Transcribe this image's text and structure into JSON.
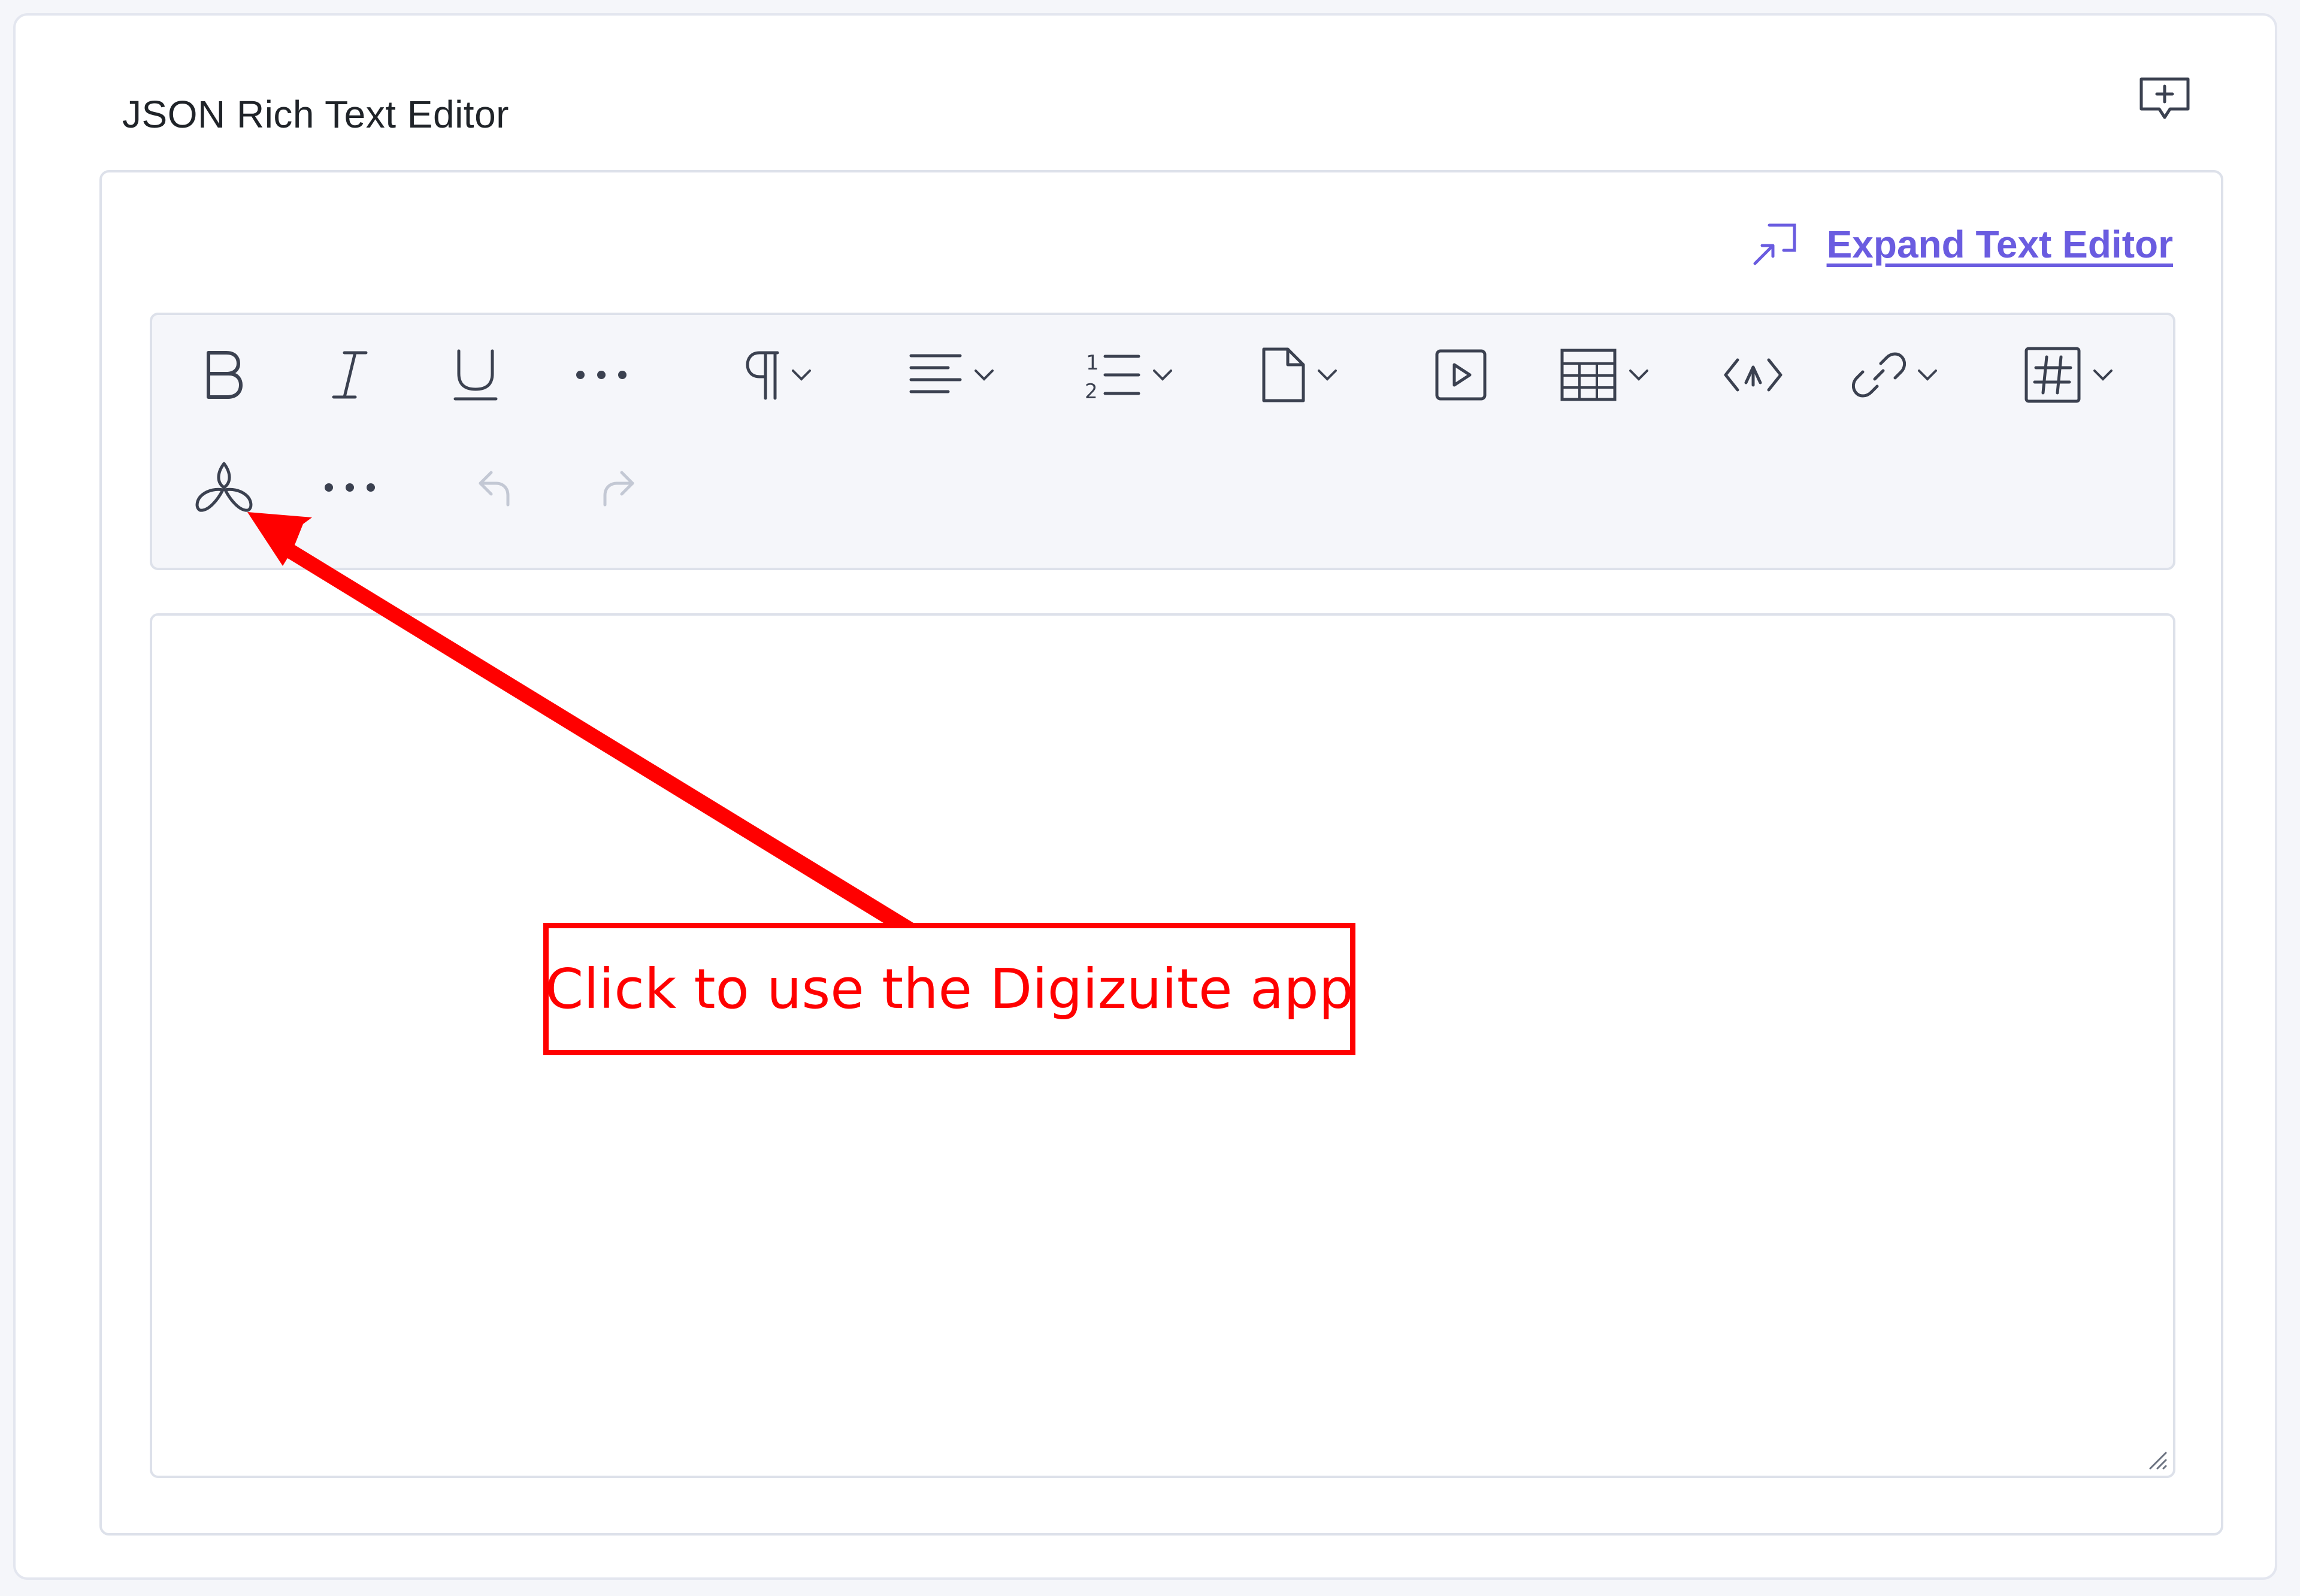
{
  "field": {
    "label": "JSON Rich Text Editor"
  },
  "header": {
    "comment_icon": "add-comment-icon"
  },
  "editor": {
    "expand_label": "Expand Text Editor",
    "expand_icon": "expand-icon",
    "content": ""
  },
  "toolbar": {
    "row1": [
      {
        "name": "bold",
        "icon": "bold-icon"
      },
      {
        "name": "italic",
        "icon": "italic-icon"
      },
      {
        "name": "underline",
        "icon": "underline-icon"
      },
      {
        "name": "more-formatting",
        "icon": "more-icon"
      },
      {
        "name": "paragraph",
        "icon": "paragraph-icon",
        "dropdown": true
      },
      {
        "name": "align",
        "icon": "align-left-icon",
        "dropdown": true
      },
      {
        "name": "list",
        "icon": "ordered-list-icon",
        "dropdown": true
      },
      {
        "name": "document",
        "icon": "document-icon",
        "dropdown": true
      },
      {
        "name": "video",
        "icon": "video-icon"
      },
      {
        "name": "table",
        "icon": "table-icon",
        "dropdown": true
      },
      {
        "name": "embed",
        "icon": "embed-code-icon"
      },
      {
        "name": "link",
        "icon": "link-icon",
        "dropdown": true
      },
      {
        "name": "hashtag",
        "icon": "hashtag-icon",
        "dropdown": true
      }
    ],
    "row2": [
      {
        "name": "digizuite",
        "icon": "digizuite-app-icon"
      },
      {
        "name": "more",
        "icon": "more-icon"
      },
      {
        "name": "undo",
        "icon": "undo-icon"
      },
      {
        "name": "redo",
        "icon": "redo-icon"
      }
    ]
  },
  "annotation": {
    "text": "Click to use the Digizuite app",
    "color": "#ff0000"
  },
  "colors": {
    "accent": "#6a5ce0",
    "icon": "#3b4150",
    "icon_disabled": "#c3c8d4",
    "annotation": "#ff0000"
  }
}
